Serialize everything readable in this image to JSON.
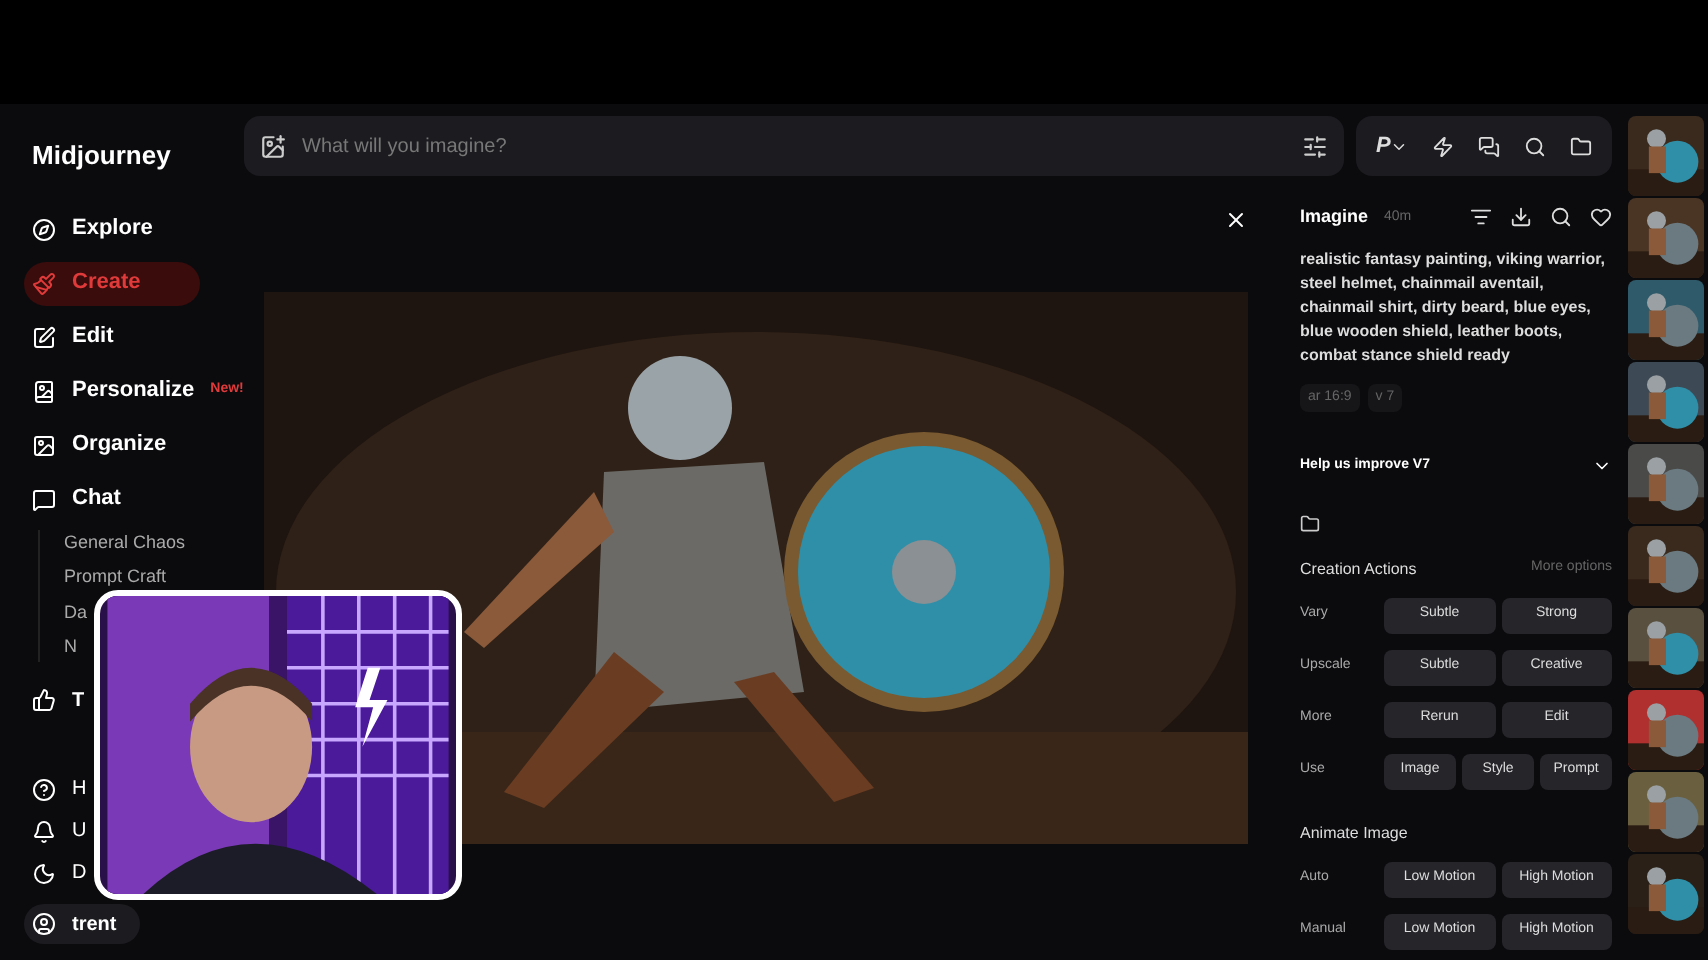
{
  "brand": "Midjourney",
  "nav": [
    {
      "label": "Explore",
      "selected": false
    },
    {
      "label": "Create",
      "selected": true
    },
    {
      "label": "Edit",
      "selected": false
    },
    {
      "label": "Personalize",
      "selected": false,
      "badge": "New!"
    },
    {
      "label": "Organize",
      "selected": false
    },
    {
      "label": "Chat",
      "selected": false
    }
  ],
  "chat_channels": [
    "General Chaos",
    "Prompt Craft",
    "Da",
    "N"
  ],
  "nav_more": [
    {
      "label": "T"
    }
  ],
  "nav_bottom": [
    {
      "label": "H"
    },
    {
      "label": "U"
    },
    {
      "label": "D"
    }
  ],
  "user": "trent",
  "search": {
    "placeholder": "What will you imagine?"
  },
  "toolbar": {
    "personalize_label": "P"
  },
  "detail": {
    "title": "Imagine",
    "time": "40m",
    "prompt": "realistic fantasy painting, viking warrior, steel helmet, chainmail aventail, chainmail shirt, dirty beard, blue eyes, blue wooden shield, leather boots, combat stance shield ready",
    "tags": [
      "ar 16:9",
      "v 7"
    ],
    "feedback": {
      "label": "Help us improve V7",
      "expanded": false
    },
    "sections": [
      {
        "title": "Creation Actions",
        "link": "More options",
        "rows": [
          {
            "label": "Vary",
            "buttons": [
              "Subtle",
              "Strong"
            ]
          },
          {
            "label": "Upscale",
            "buttons": [
              "Subtle",
              "Creative"
            ]
          },
          {
            "label": "More",
            "buttons": [
              "Rerun",
              "Edit"
            ]
          },
          {
            "label": "Use",
            "buttons": [
              "Image",
              "Style",
              "Prompt"
            ]
          }
        ]
      },
      {
        "title": "Animate Image",
        "rows": [
          {
            "label": "Auto",
            "buttons": [
              "Low Motion",
              "High Motion"
            ]
          },
          {
            "label": "Manual",
            "buttons": [
              "Low Motion",
              "High Motion"
            ]
          }
        ]
      }
    ]
  }
}
